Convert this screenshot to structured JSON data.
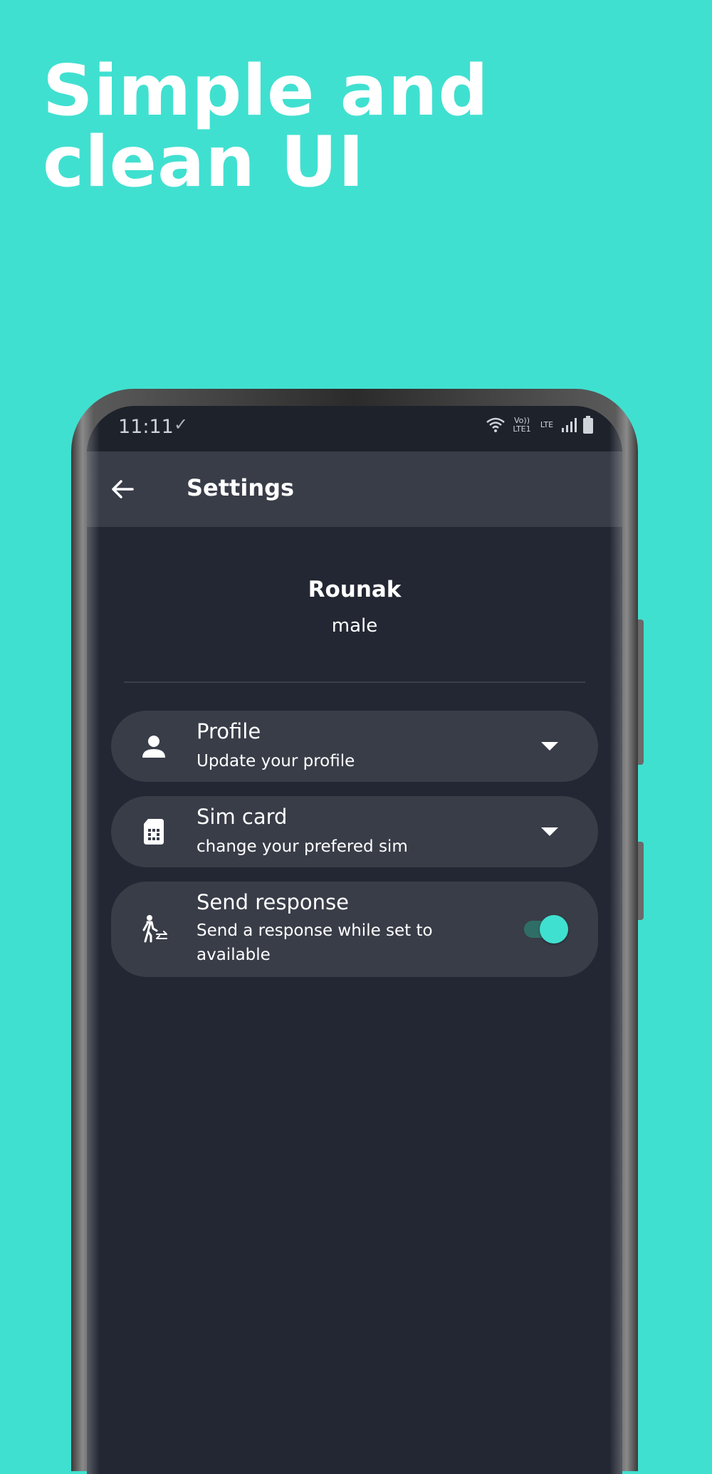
{
  "headline": {
    "line1": "Simple and",
    "line2": "clean UI"
  },
  "status_bar": {
    "time": "11:11",
    "check": "✓",
    "volte_label": "Vo)) LTE1",
    "lte_label": "LTE"
  },
  "app_bar": {
    "title": "Settings",
    "back_icon": "arrow-left-icon"
  },
  "user": {
    "name": "Rounak",
    "gender": "male"
  },
  "settings": [
    {
      "title": "Profile",
      "subtitle": "Update your profile",
      "icon": "person-icon",
      "control": "dropdown"
    },
    {
      "title": "Sim card",
      "subtitle": "change your prefered sim",
      "icon": "sim-card-icon",
      "control": "dropdown"
    },
    {
      "title": "Send response",
      "subtitle": "Send a response while set to available",
      "icon": "walking-transfer-icon",
      "control": "toggle",
      "toggle_on": true
    }
  ],
  "colors": {
    "background": "#40e0d0",
    "screen": "#222733",
    "card": "#393d48",
    "accent": "#40e0d0"
  }
}
